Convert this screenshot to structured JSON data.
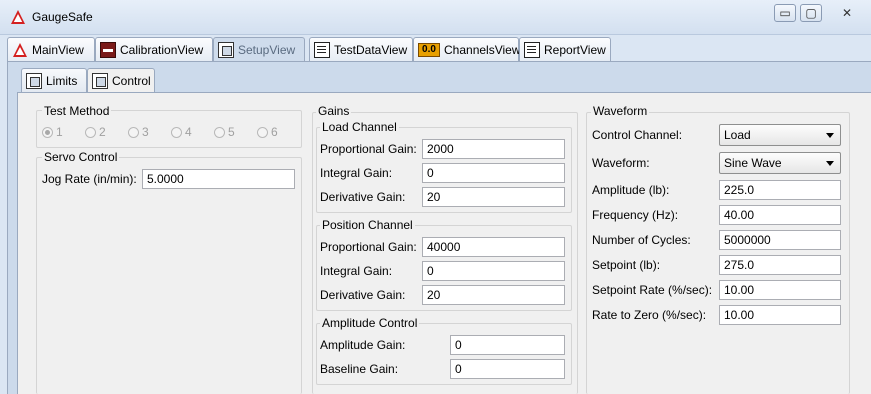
{
  "app": {
    "title": "GaugeSafe",
    "window_buttons": {
      "minimize": "▭",
      "maximize": "▢",
      "close": "✕"
    }
  },
  "main_tabs": [
    {
      "label": "MainView",
      "icon": "warning-triangle-icon"
    },
    {
      "label": "CalibrationView",
      "icon": "calibration-icon"
    },
    {
      "label": "SetupView",
      "icon": "setup-icon",
      "active": true
    },
    {
      "label": "TestDataView",
      "icon": "document-icon"
    },
    {
      "label": "ChannelsView",
      "icon": "channels-icon",
      "icon_text": "0.0"
    },
    {
      "label": "ReportView",
      "icon": "document-icon"
    }
  ],
  "sub_tabs": [
    {
      "label": "Limits"
    },
    {
      "label": "Control",
      "active": true
    }
  ],
  "test_method": {
    "title": "Test Method",
    "options": [
      "1",
      "2",
      "3",
      "4",
      "5",
      "6"
    ],
    "selected": "1"
  },
  "servo_control": {
    "title": "Servo Control",
    "jog_rate_label": "Jog Rate (in/min):",
    "jog_rate_value": "5.0000"
  },
  "gains": {
    "title": "Gains",
    "load_channel": {
      "title": "Load Channel",
      "proportional_label": "Proportional Gain:",
      "proportional_value": "2000",
      "integral_label": "Integral Gain:",
      "integral_value": "0",
      "derivative_label": "Derivative Gain:",
      "derivative_value": "20"
    },
    "position_channel": {
      "title": "Position Channel",
      "proportional_label": "Proportional Gain:",
      "proportional_value": "40000",
      "integral_label": "Integral Gain:",
      "integral_value": "0",
      "derivative_label": "Derivative Gain:",
      "derivative_value": "20"
    },
    "amplitude_control": {
      "title": "Amplitude Control",
      "amplitude_label": "Amplitude Gain:",
      "amplitude_value": "0",
      "baseline_label": "Baseline Gain:",
      "baseline_value": "0"
    }
  },
  "waveform": {
    "title": "Waveform",
    "control_channel_label": "Control Channel:",
    "control_channel_value": "Load",
    "waveform_label": "Waveform:",
    "waveform_value": "Sine Wave",
    "amplitude_label": "Amplitude (lb):",
    "amplitude_value": "225.0",
    "frequency_label": "Frequency (Hz):",
    "frequency_value": "40.00",
    "cycles_label": "Number of Cycles:",
    "cycles_value": "5000000",
    "setpoint_label": "Setpoint (lb):",
    "setpoint_value": "275.0",
    "setpoint_rate_label": "Setpoint Rate (%/sec):",
    "setpoint_rate_value": "10.00",
    "rate_to_zero_label": "Rate to Zero (%/sec):",
    "rate_to_zero_value": "10.00"
  },
  "colors": {
    "accent_red": "#d42020",
    "channels_icon": "#e8a000"
  }
}
